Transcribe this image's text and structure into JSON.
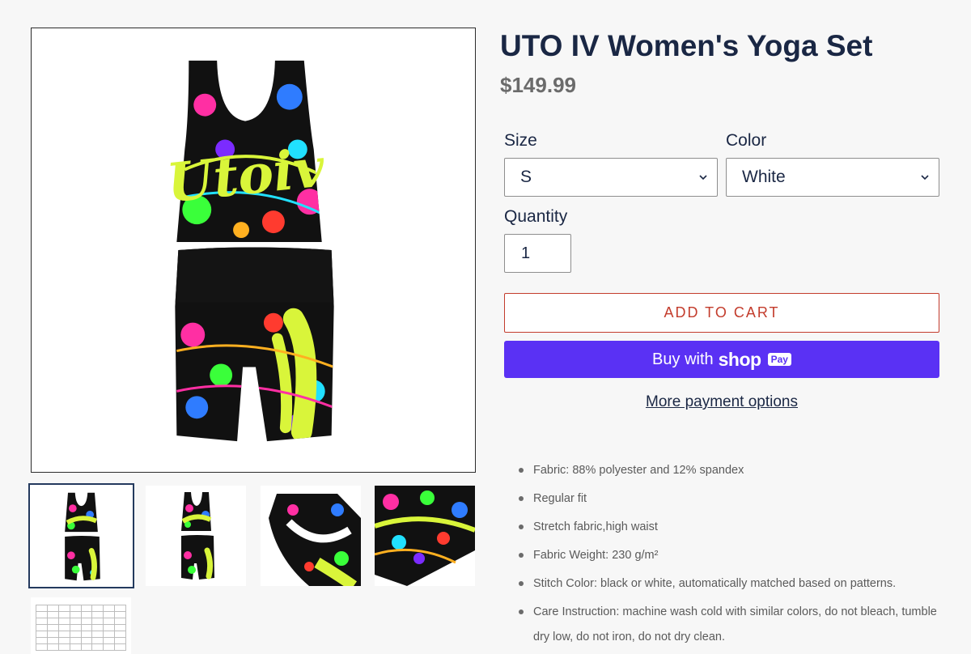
{
  "product": {
    "title": "UTO IV Women's Yoga Set",
    "price": "$149.99",
    "image_text": "Utoiv"
  },
  "options": {
    "size": {
      "label": "Size",
      "value": "S"
    },
    "color": {
      "label": "Color",
      "value": "White"
    },
    "quantity": {
      "label": "Quantity",
      "value": "1"
    }
  },
  "buttons": {
    "add_to_cart": "ADD TO CART",
    "buy_with": "Buy with",
    "shop_word": "shop",
    "pay_badge": "Pay",
    "more_payment": "More payment options"
  },
  "features": [
    "Fabric: 88% polyester and 12% spandex",
    "Regular fit",
    "Stretch fabric,high waist",
    "Fabric Weight: 230 g/m²",
    "Stitch Color: black or white, automatically matched based on patterns.",
    "Care Instruction: machine wash cold with similar colors, do not bleach, tumble dry low, do not iron, do not dry clean."
  ],
  "colors": {
    "navy": "#1a2744",
    "price_gray": "#6b6b6b",
    "cart_red": "#c33c2c",
    "shop_purple": "#5a31f4",
    "neon_yellow": "#d9f53a"
  }
}
